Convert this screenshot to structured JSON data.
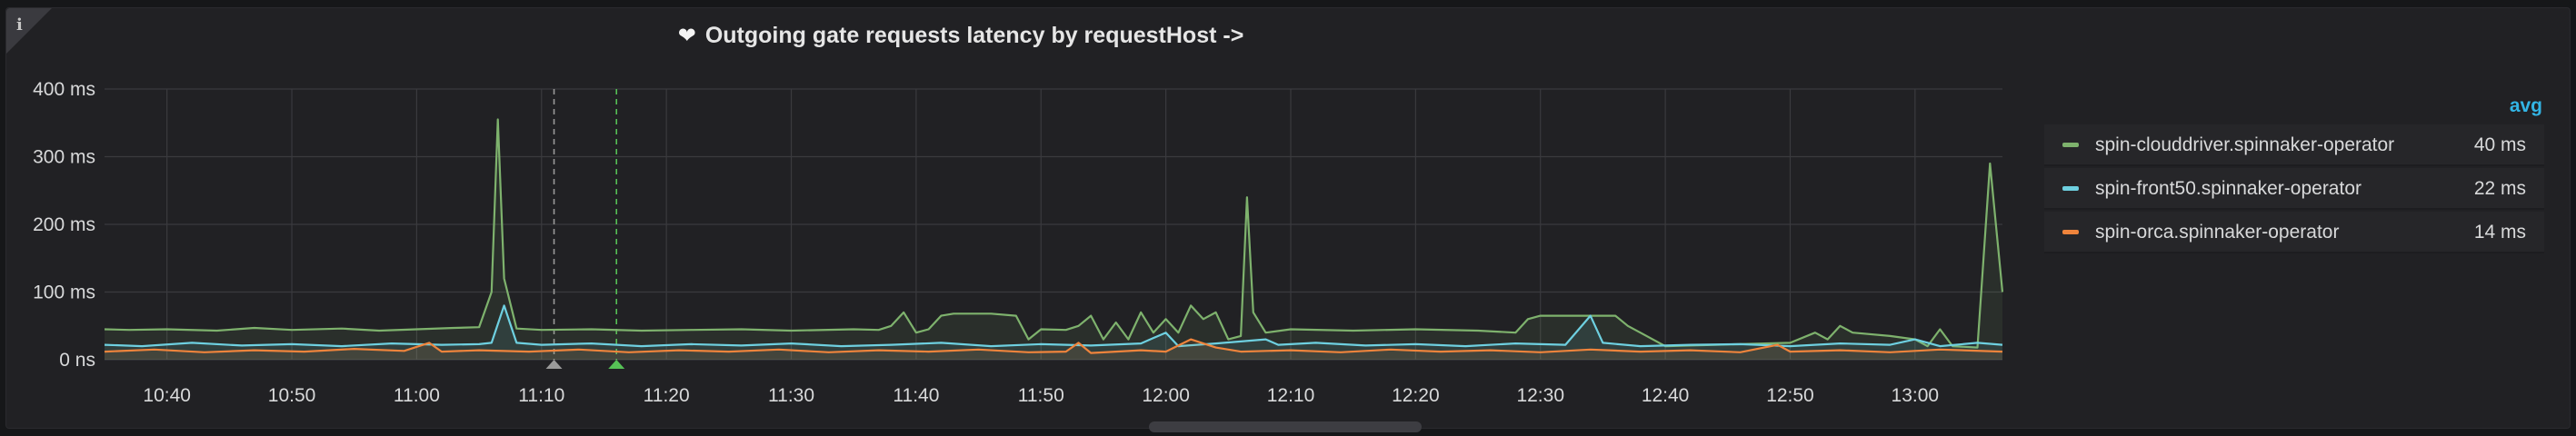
{
  "panel": {
    "title": "Outgoing gate requests latency by requestHost ->",
    "title_icon": "heart-icon",
    "info_icon": "info-icon",
    "info_glyph": "i"
  },
  "legend": {
    "header": "avg",
    "header_color": "#33b5e5",
    "items": [
      {
        "name": "spin-clouddriver.spinnaker-operator",
        "avg": "40 ms",
        "color": "#7eb26d"
      },
      {
        "name": "spin-front50.spinnaker-operator",
        "avg": "22 ms",
        "color": "#6ed0e0"
      },
      {
        "name": "spin-orca.spinnaker-operator",
        "avg": "14 ms",
        "color": "#ef843c"
      }
    ]
  },
  "chart_data": {
    "type": "line",
    "title": "Outgoing gate requests latency by requestHost ->",
    "xlabel": "",
    "ylabel": "",
    "ylim": [
      0,
      400
    ],
    "xlim": [
      "10:35",
      "13:07"
    ],
    "y_ticks": [
      "0 ns",
      "100 ms",
      "200 ms",
      "300 ms",
      "400 ms"
    ],
    "y_tick_values": [
      0,
      100,
      200,
      300,
      400
    ],
    "x_ticks": [
      "10:40",
      "10:50",
      "11:00",
      "11:10",
      "11:20",
      "11:30",
      "11:40",
      "11:50",
      "12:00",
      "12:10",
      "12:20",
      "12:30",
      "12:40",
      "12:50",
      "13:00"
    ],
    "grid": true,
    "legend_position": "right",
    "annotations": [
      {
        "time": "11:11",
        "color": "#9a9a9a"
      },
      {
        "time": "11:16",
        "color": "#56c156"
      }
    ],
    "series": [
      {
        "name": "spin-clouddriver.spinnaker-operator",
        "color": "#7eb26d",
        "points": [
          [
            "10:35",
            45
          ],
          [
            "10:37",
            44
          ],
          [
            "10:40",
            45
          ],
          [
            "10:44",
            43
          ],
          [
            "10:47",
            47
          ],
          [
            "10:50",
            44
          ],
          [
            "10:54",
            46
          ],
          [
            "10:57",
            43
          ],
          [
            "11:00",
            45
          ],
          [
            "11:03",
            47
          ],
          [
            "11:05",
            48
          ],
          [
            "11:06",
            100
          ],
          [
            "11:06.5",
            355
          ],
          [
            "11:07",
            120
          ],
          [
            "11:08",
            46
          ],
          [
            "11:10",
            44
          ],
          [
            "11:14",
            45
          ],
          [
            "11:18",
            43
          ],
          [
            "11:22",
            44
          ],
          [
            "11:26",
            45
          ],
          [
            "11:30",
            43
          ],
          [
            "11:35",
            45
          ],
          [
            "11:37",
            44
          ],
          [
            "11:38",
            50
          ],
          [
            "11:39",
            70
          ],
          [
            "11:40",
            40
          ],
          [
            "11:41",
            45
          ],
          [
            "11:42",
            65
          ],
          [
            "11:43",
            68
          ],
          [
            "11:46",
            68
          ],
          [
            "11:48",
            65
          ],
          [
            "11:49",
            30
          ],
          [
            "11:50",
            45
          ],
          [
            "11:52",
            44
          ],
          [
            "11:53",
            50
          ],
          [
            "11:54",
            65
          ],
          [
            "11:55",
            30
          ],
          [
            "11:56",
            55
          ],
          [
            "11:57",
            30
          ],
          [
            "11:58",
            70
          ],
          [
            "11:59",
            40
          ],
          [
            "12:00",
            60
          ],
          [
            "12:01",
            40
          ],
          [
            "12:02",
            80
          ],
          [
            "12:03",
            60
          ],
          [
            "12:04",
            70
          ],
          [
            "12:05",
            30
          ],
          [
            "12:06",
            35
          ],
          [
            "12:06.5",
            240
          ],
          [
            "12:07",
            70
          ],
          [
            "12:08",
            40
          ],
          [
            "12:10",
            45
          ],
          [
            "12:15",
            43
          ],
          [
            "12:20",
            45
          ],
          [
            "12:25",
            43
          ],
          [
            "12:28",
            40
          ],
          [
            "12:29",
            60
          ],
          [
            "12:30",
            65
          ],
          [
            "12:36",
            65
          ],
          [
            "12:37",
            50
          ],
          [
            "12:38",
            40
          ],
          [
            "12:40",
            20
          ],
          [
            "12:44",
            22
          ],
          [
            "12:48",
            24
          ],
          [
            "12:50",
            25
          ],
          [
            "12:52",
            40
          ],
          [
            "12:53",
            30
          ],
          [
            "12:54",
            50
          ],
          [
            "12:55",
            40
          ],
          [
            "12:58",
            35
          ],
          [
            "13:00",
            30
          ],
          [
            "13:01",
            20
          ],
          [
            "13:02",
            45
          ],
          [
            "13:03",
            20
          ],
          [
            "13:05",
            18
          ],
          [
            "13:06",
            290
          ],
          [
            "13:07",
            100
          ]
        ]
      },
      {
        "name": "spin-front50.spinnaker-operator",
        "color": "#6ed0e0",
        "points": [
          [
            "10:35",
            22
          ],
          [
            "10:38",
            20
          ],
          [
            "10:42",
            25
          ],
          [
            "10:46",
            21
          ],
          [
            "10:50",
            23
          ],
          [
            "10:54",
            20
          ],
          [
            "10:58",
            24
          ],
          [
            "11:02",
            22
          ],
          [
            "11:05",
            23
          ],
          [
            "11:06",
            25
          ],
          [
            "11:07",
            80
          ],
          [
            "11:08",
            25
          ],
          [
            "11:10",
            22
          ],
          [
            "11:14",
            24
          ],
          [
            "11:18",
            20
          ],
          [
            "11:22",
            23
          ],
          [
            "11:26",
            21
          ],
          [
            "11:30",
            24
          ],
          [
            "11:34",
            20
          ],
          [
            "11:38",
            22
          ],
          [
            "11:42",
            25
          ],
          [
            "11:46",
            20
          ],
          [
            "11:50",
            23
          ],
          [
            "11:54",
            21
          ],
          [
            "11:58",
            24
          ],
          [
            "12:00",
            40
          ],
          [
            "12:01",
            20
          ],
          [
            "12:04",
            24
          ],
          [
            "12:08",
            30
          ],
          [
            "12:09",
            22
          ],
          [
            "12:12",
            25
          ],
          [
            "12:16",
            21
          ],
          [
            "12:20",
            23
          ],
          [
            "12:24",
            20
          ],
          [
            "12:28",
            24
          ],
          [
            "12:32",
            22
          ],
          [
            "12:34",
            65
          ],
          [
            "12:35",
            25
          ],
          [
            "12:38",
            20
          ],
          [
            "12:42",
            22
          ],
          [
            "12:46",
            23
          ],
          [
            "12:50",
            20
          ],
          [
            "12:54",
            24
          ],
          [
            "12:58",
            22
          ],
          [
            "13:00",
            30
          ],
          [
            "13:02",
            20
          ],
          [
            "13:05",
            25
          ],
          [
            "13:07",
            22
          ]
        ]
      },
      {
        "name": "spin-orca.spinnaker-operator",
        "color": "#ef843c",
        "points": [
          [
            "10:35",
            12
          ],
          [
            "10:39",
            15
          ],
          [
            "10:43",
            11
          ],
          [
            "10:47",
            14
          ],
          [
            "10:51",
            12
          ],
          [
            "10:55",
            16
          ],
          [
            "10:59",
            13
          ],
          [
            "11:01",
            25
          ],
          [
            "11:02",
            12
          ],
          [
            "11:05",
            14
          ],
          [
            "11:09",
            12
          ],
          [
            "11:13",
            15
          ],
          [
            "11:17",
            11
          ],
          [
            "11:21",
            14
          ],
          [
            "11:25",
            12
          ],
          [
            "11:29",
            15
          ],
          [
            "11:33",
            11
          ],
          [
            "11:37",
            14
          ],
          [
            "11:41",
            12
          ],
          [
            "11:45",
            15
          ],
          [
            "11:49",
            11
          ],
          [
            "11:52",
            12
          ],
          [
            "11:53",
            25
          ],
          [
            "11:54",
            10
          ],
          [
            "11:58",
            14
          ],
          [
            "12:00",
            12
          ],
          [
            "12:02",
            30
          ],
          [
            "12:04",
            18
          ],
          [
            "12:06",
            12
          ],
          [
            "12:10",
            14
          ],
          [
            "12:14",
            11
          ],
          [
            "12:18",
            15
          ],
          [
            "12:22",
            12
          ],
          [
            "12:26",
            14
          ],
          [
            "12:30",
            11
          ],
          [
            "12:34",
            15
          ],
          [
            "12:38",
            12
          ],
          [
            "12:42",
            14
          ],
          [
            "12:46",
            11
          ],
          [
            "12:49",
            22
          ],
          [
            "12:50",
            12
          ],
          [
            "12:54",
            14
          ],
          [
            "12:58",
            11
          ],
          [
            "13:02",
            15
          ],
          [
            "13:07",
            12
          ]
        ]
      }
    ]
  }
}
